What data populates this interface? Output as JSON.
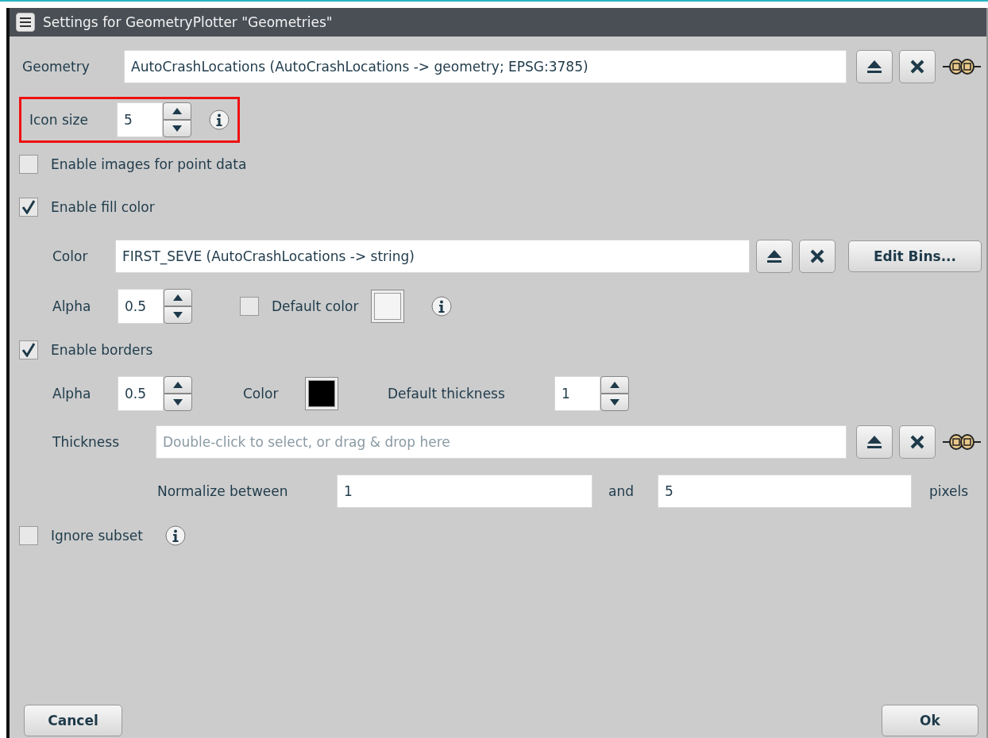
{
  "window": {
    "title": "Settings for GeometryPlotter \"Geometries\""
  },
  "geometry": {
    "label": "Geometry",
    "value": "AutoCrashLocations (AutoCrashLocations -> geometry; EPSG:3785)"
  },
  "icon_size": {
    "label": "Icon size",
    "value": "5",
    "highlighted": true
  },
  "enable_images": {
    "label": "Enable images for point data",
    "checked": false
  },
  "enable_fill": {
    "label": "Enable fill color",
    "checked": true
  },
  "fill": {
    "color_label": "Color",
    "color_value": "FIRST_SEVE (AutoCrashLocations -> string)",
    "edit_bins": "Edit Bins...",
    "alpha_label": "Alpha",
    "alpha_value": "0.5",
    "default_color": {
      "label": "Default color",
      "checked": false,
      "color": "#f4f4f4"
    }
  },
  "enable_borders": {
    "label": "Enable borders",
    "checked": true
  },
  "borders": {
    "alpha_label": "Alpha",
    "alpha_value": "0.5",
    "color_label": "Color",
    "color": "#000000",
    "default_thickness_label": "Default thickness",
    "default_thickness_value": "1",
    "thickness_label": "Thickness",
    "thickness_placeholder": "Double-click to select, or drag & drop here",
    "normalize_label": "Normalize between",
    "min": "1",
    "and_label": "and",
    "max": "5",
    "unit": "pixels"
  },
  "ignore_subset": {
    "label": "Ignore subset",
    "checked": false
  },
  "buttons": {
    "cancel": "Cancel",
    "ok": "Ok"
  }
}
